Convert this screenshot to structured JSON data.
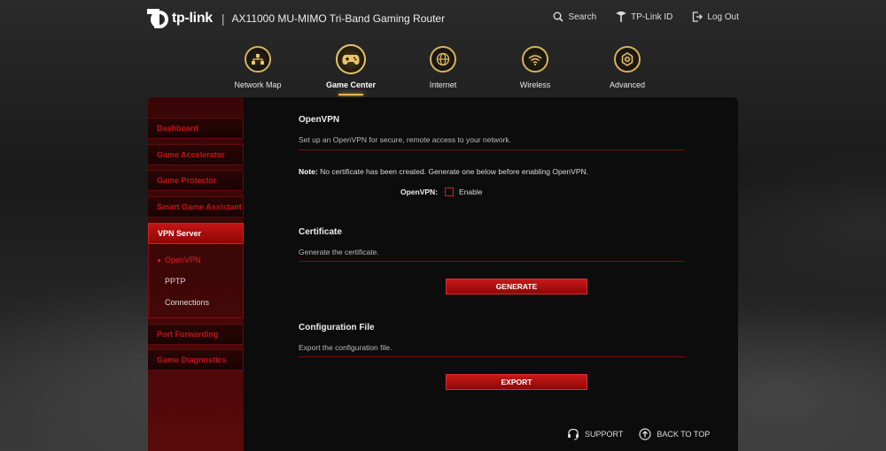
{
  "header": {
    "brand": "tp-link",
    "model": "AX11000 MU-MIMO Tri-Band Gaming Router",
    "actions": [
      {
        "label": "Search",
        "icon": "search-icon"
      },
      {
        "label": "TP-Link ID",
        "icon": "tplink-id-icon"
      },
      {
        "label": "Log Out",
        "icon": "logout-icon"
      }
    ]
  },
  "nav": {
    "items": [
      {
        "label": "Network Map",
        "icon": "network-map-icon"
      },
      {
        "label": "Game Center",
        "icon": "gamepad-icon",
        "active": true
      },
      {
        "label": "Internet",
        "icon": "globe-icon"
      },
      {
        "label": "Wireless",
        "icon": "wifi-icon"
      },
      {
        "label": "Advanced",
        "icon": "gear-icon"
      }
    ]
  },
  "sidebar": {
    "items": [
      {
        "label": "Dashboard"
      },
      {
        "label": "Game Accelerator"
      },
      {
        "label": "Game Protector"
      },
      {
        "label": "Smart Game Assistant"
      },
      {
        "label": "VPN Server",
        "active": true
      },
      {
        "label": "Port Forwarding"
      },
      {
        "label": "Game Diagnostics"
      }
    ],
    "sub_items": [
      {
        "label": "OpenVPN",
        "active": true
      },
      {
        "label": "PPTP"
      },
      {
        "label": "Connections"
      }
    ]
  },
  "openvpn": {
    "title": "OpenVPN",
    "description": "Set up an OpenVPN for secure, remote access to your network.",
    "note_label": "Note:",
    "note_text": " No certificate has been created. Generate one below before enabling OpenVPN.",
    "field_label": "OpenVPN:",
    "enable_label": "Enable",
    "enabled": false
  },
  "certificate": {
    "title": "Certificate",
    "description": "Generate the certificate.",
    "button": "GENERATE"
  },
  "config": {
    "title": "Configuration File",
    "description": "Export the configuration file.",
    "button": "EXPORT"
  },
  "footer": {
    "support": "SUPPORT",
    "back_to_top": "BACK TO TOP"
  },
  "colors": {
    "accent_red": "#c81818",
    "nav_gold": "#e9c46a",
    "panel_bg": "#0c0c0c"
  }
}
